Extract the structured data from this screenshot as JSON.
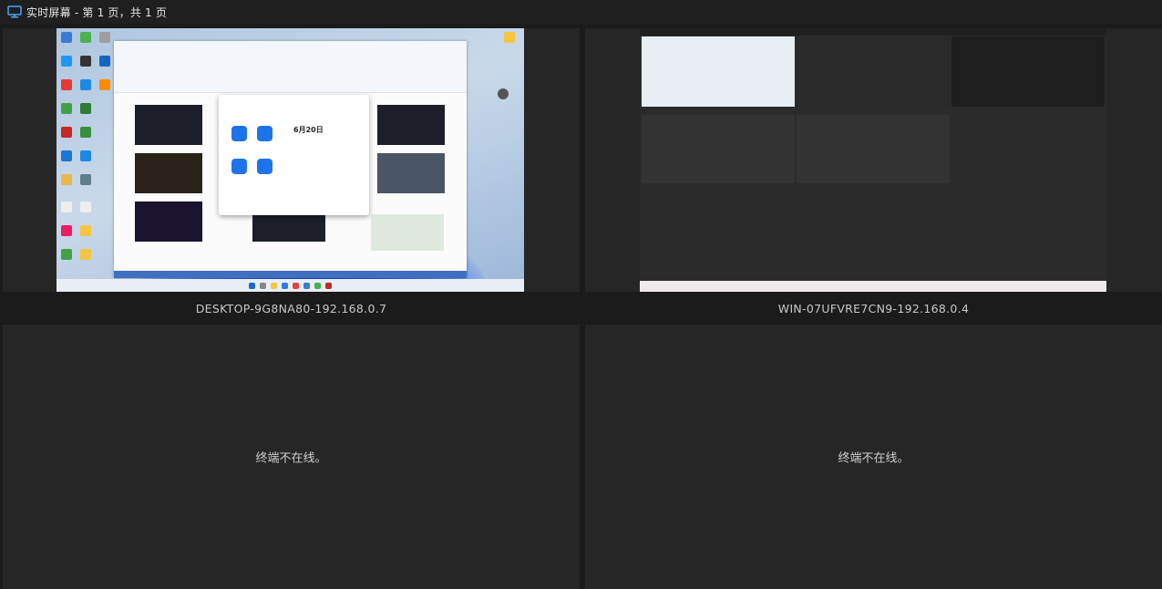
{
  "window": {
    "title": "实时屏幕 - 第 1 页，共 1 页",
    "icon": "monitor-icon"
  },
  "screens": [
    {
      "label": "DESKTOP-9G8NA80-192.168.0.7",
      "online": true
    },
    {
      "label": "WIN-07UFVRE7CN9-192.168.0.4",
      "online": true
    },
    {
      "status": "终端不在线。",
      "online": false
    },
    {
      "status": "终端不在线。",
      "online": false
    }
  ],
  "thumbnail1": {
    "dialog_date": "6月20日"
  },
  "colors": {
    "background": "#1b1b1b",
    "cell": "#262626",
    "text": "#d4d4d4"
  }
}
